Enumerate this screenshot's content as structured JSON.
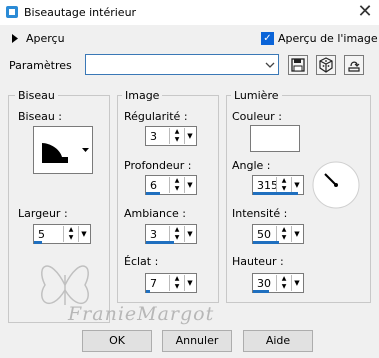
{
  "window": {
    "title": "Biseautage intérieur",
    "close_glyph": "✕"
  },
  "preview": {
    "toggle_label": "Aperçu",
    "checkbox_label": "Aperçu de l'image",
    "checked": true
  },
  "params": {
    "label": "Paramètres",
    "value": ""
  },
  "biseau": {
    "group_title": "Biseau",
    "bevel_label": "Biseau :",
    "largeur_label": "Largeur :",
    "largeur_value": "5"
  },
  "image": {
    "group_title": "Image",
    "regularite_label": "Régularité :",
    "regularite_value": "3",
    "profondeur_label": "Profondeur :",
    "profondeur_value": "6",
    "ambiance_label": "Ambiance :",
    "ambiance_value": "3",
    "eclat_label": "Éclat :",
    "eclat_value": "7"
  },
  "lumiere": {
    "group_title": "Lumière",
    "couleur_label": "Couleur :",
    "couleur_value": "#ffffff",
    "angle_label": "Angle :",
    "angle_value": "315",
    "intensite_label": "Intensité :",
    "intensite_value": "50",
    "hauteur_label": "Hauteur :",
    "hauteur_value": "30"
  },
  "buttons": {
    "ok": "OK",
    "cancel": "Annuler",
    "help": "Aide"
  },
  "watermark": {
    "text": "FranieMargot"
  },
  "icons": {
    "app": "bevel-app-icon",
    "expand": "triangle-right-icon",
    "combo": "chevron-down-icon",
    "save": "save-icon",
    "preset": "cube-icon",
    "reset": "reset-icon"
  },
  "colors": {
    "accent": "#1f6fbf",
    "checkbox": "#0a64d8",
    "bg": "#f0f0f0"
  }
}
